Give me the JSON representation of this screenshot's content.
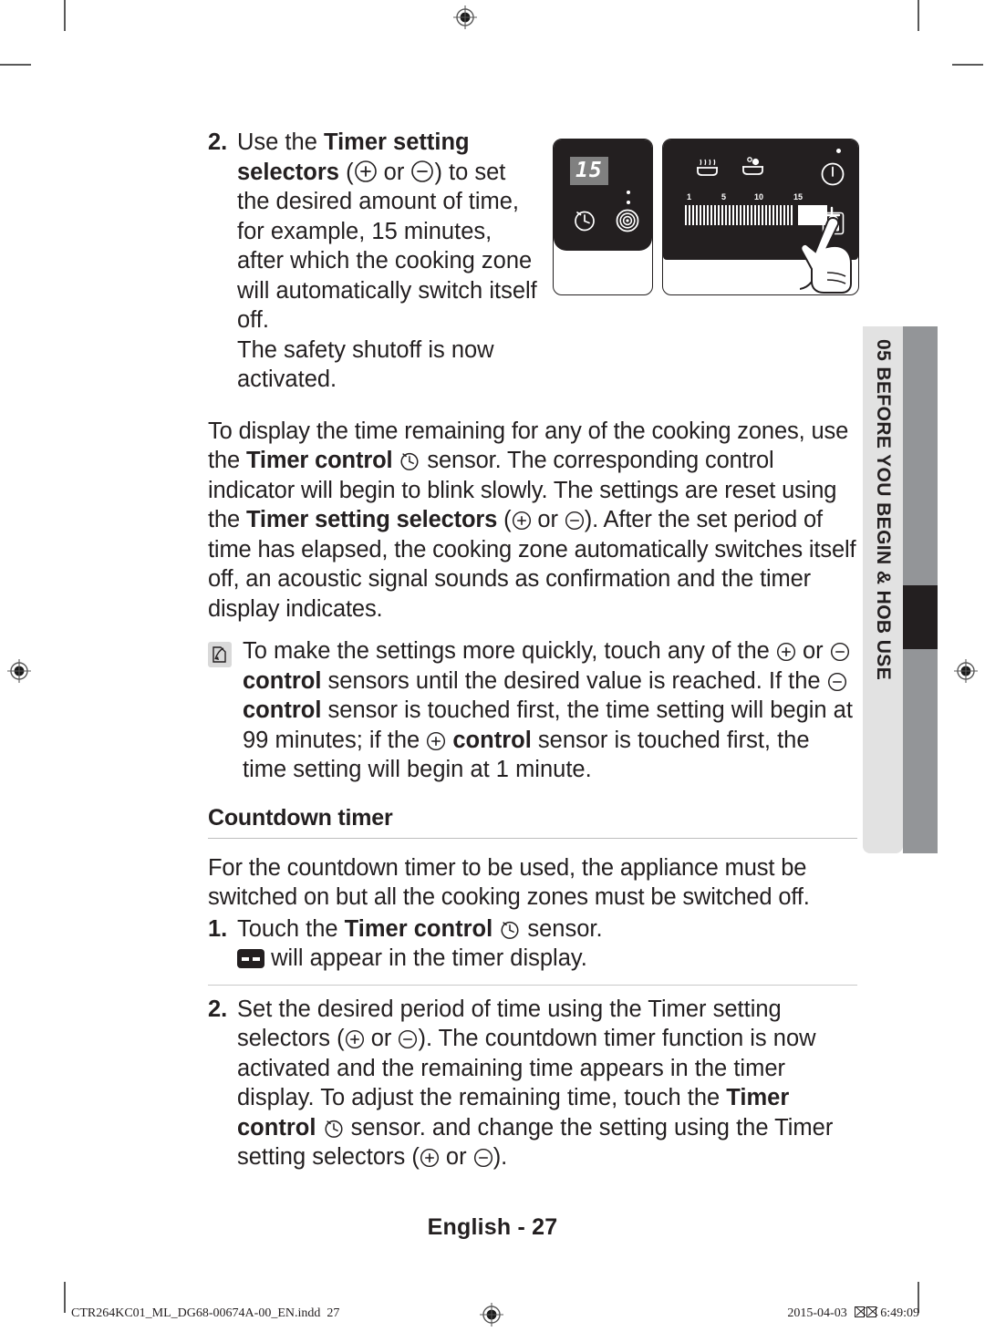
{
  "document": {
    "page_label": "English - 27",
    "side_tab": {
      "number_and_title": "05 BEFORE YOU BEGIN & HOB USE"
    },
    "print_footer": {
      "file_name": "CTR264KC01_ML_DG68-00674A-00_EN.indd",
      "file_page": "27",
      "date": "2015-04-03",
      "time": "6:49:09"
    }
  },
  "step_2_top": {
    "number": "2.",
    "line_1a": "Use the ",
    "line_1b": "Timer setting",
    "line_2a": "selectors",
    "line_2b": " or ",
    "line_2c": ") to set",
    "line_3": "the desired amount of time,",
    "line_4": "for example, 15 minutes,",
    "line_5": "after which the cooking zone",
    "line_6": "will automatically switch itself",
    "line_7": "off.",
    "line_8": "The safety shutoff is now activated."
  },
  "timer_display_para": {
    "part_1": "To display the time remaining for any of the cooking zones, use the ",
    "bold_1": "Timer control",
    "part_2": " sensor.",
    "part_3": "The corresponding control indicator will begin to blink slowly. The settings are reset using the ",
    "bold_2": "Timer setting selectors",
    "part_4": " or ",
    "part_5": "). After the set period of time has elapsed, the cooking zone automatically switches itself off, an acoustic signal sounds as confirmation and the timer display indicates."
  },
  "note": {
    "part_1": "To make the settings more quickly, touch any of the ",
    "part_2": " or ",
    "bold_1": "control",
    "part_3": " sensors until the desired value is reached. If the ",
    "bold_2": "control",
    "part_4": " sensor is touched first, the time setting will begin at 99 minutes; if the ",
    "bold_3": "control",
    "part_5": " sensor is touched first, the time setting will begin at 1 minute."
  },
  "countdown_section": {
    "heading": "Countdown timer",
    "intro": "For the countdown timer to be used, the appliance must be switched on but all the cooking zones must be switched off.",
    "step_1": {
      "number": "1.",
      "part_1": "Touch the ",
      "bold_1": "Timer control",
      "part_2": " sensor.",
      "part_3": " will appear in the timer display.",
      "display_value": "--"
    },
    "step_2": {
      "number": "2.",
      "part_1": "Set the desired period of time using the Timer setting selectors (",
      "part_2": " or ",
      "part_3": ").",
      "part_4": "The countdown timer function is now activated and the remaining time appears in the timer display.",
      "part_5": "To adjust the remaining time, touch the ",
      "bold_1": "Timer control",
      "part_6": " sensor. and change the setting using the Timer setting selectors (",
      "part_7": " or ",
      "part_8": ")."
    }
  },
  "figure": {
    "caption_implied": "hob control panel with timer set to 15 minutes",
    "left_panel": {
      "timer_display_value": "15",
      "icons": [
        "timer-clock-icon",
        "cooking-zone-icon"
      ],
      "indicator_dots": 2
    },
    "right_panel": {
      "icons": [
        "keep-warm-icon",
        "simmer-icon",
        "power-icon",
        "lock-icon",
        "plus-icon"
      ],
      "scale_labels": [
        "1",
        "5",
        "10",
        "15"
      ],
      "plus_symbol": "+",
      "finger": "pointing-hand"
    }
  },
  "colors": {
    "text": "#231f20",
    "panel_black": "#231f20",
    "display_gray": "#808080",
    "tab_light": "#e2e2e2",
    "tab_gray": "#939598",
    "rule": "#c9c9c9"
  }
}
